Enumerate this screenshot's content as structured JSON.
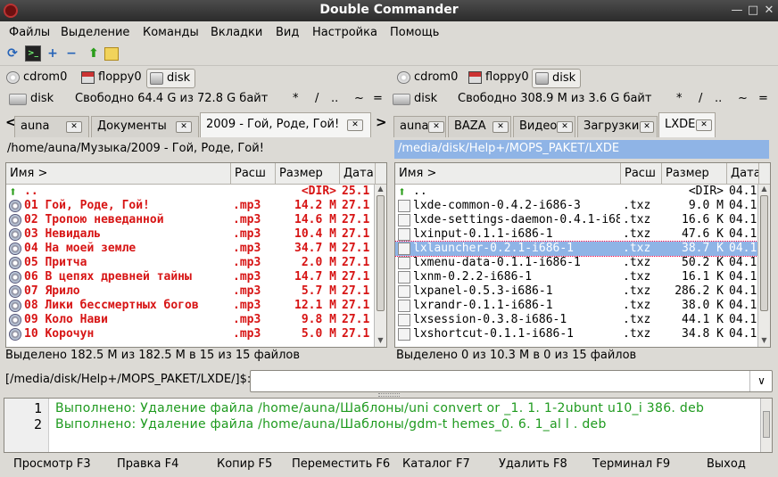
{
  "window": {
    "title": "Double Commander"
  },
  "menu": [
    "Файлы",
    "Выделение",
    "Команды",
    "Вкладки",
    "Вид",
    "Настройка",
    "Помощь"
  ],
  "drives": {
    "left": [
      "cdrom0",
      "floppy0",
      "disk"
    ],
    "right": [
      "cdrom0",
      "floppy0",
      "disk"
    ],
    "selected": "disk"
  },
  "left": {
    "disk_label": "disk",
    "free_text": "Свободно 64.4 G из 72.8 G байт",
    "nav": [
      "*",
      "/",
      "..",
      "~",
      "="
    ],
    "tabs": [
      {
        "label": "auna"
      },
      {
        "label": "Документы"
      },
      {
        "label": "2009 - Гой, Роде, Гой!"
      }
    ],
    "active_tab": 2,
    "path": "/home/auna/Музыка/2009 - Гой, Роде, Гой!",
    "columns": [
      "Имя >",
      "Расш",
      "Размер",
      "Дата"
    ],
    "files": [
      {
        "name": "..",
        "ext": "",
        "size": "<DIR>",
        "date": "25.1",
        "icon": "up-icon",
        "red": true
      },
      {
        "name": "01 Гой, Роде, Гой!",
        "ext": ".mp3",
        "size": "14.2 M",
        "date": "27.1",
        "icon": "audio-disc-icon",
        "red": true
      },
      {
        "name": "02 Тропою неведанной",
        "ext": ".mp3",
        "size": "14.6 M",
        "date": "27.1",
        "icon": "audio-disc-icon",
        "red": true
      },
      {
        "name": "03 Невидаль",
        "ext": ".mp3",
        "size": "10.4 M",
        "date": "27.1",
        "icon": "audio-disc-icon",
        "red": true
      },
      {
        "name": "04 На моей земле",
        "ext": ".mp3",
        "size": "34.7 M",
        "date": "27.1",
        "icon": "audio-disc-icon",
        "red": true
      },
      {
        "name": "05 Притча",
        "ext": ".mp3",
        "size": "2.0 M",
        "date": "27.1",
        "icon": "audio-disc-icon",
        "red": true
      },
      {
        "name": "06 В цепях древней тайны",
        "ext": ".mp3",
        "size": "14.7 M",
        "date": "27.1",
        "icon": "audio-disc-icon",
        "red": true
      },
      {
        "name": "07 Ярило",
        "ext": ".mp3",
        "size": "5.7 M",
        "date": "27.1",
        "icon": "audio-disc-icon",
        "red": true
      },
      {
        "name": "08 Лики бессмертных богов",
        "ext": ".mp3",
        "size": "12.1 M",
        "date": "27.1",
        "icon": "audio-disc-icon",
        "red": true
      },
      {
        "name": "09 Коло Нави",
        "ext": ".mp3",
        "size": "9.8 M",
        "date": "27.1",
        "icon": "audio-disc-icon",
        "red": true
      },
      {
        "name": "10 Корочун",
        "ext": ".mp3",
        "size": "5.0 M",
        "date": "27.1",
        "icon": "audio-disc-icon",
        "red": true
      }
    ],
    "status": "Выделено 182.5 M из 182.5 M в 15 из 15 файлов"
  },
  "right": {
    "disk_label": "disk",
    "free_text": "Свободно 308.9 M из 3.6 G байт",
    "nav": [
      "*",
      "/",
      "..",
      "~",
      "="
    ],
    "tabs": [
      {
        "label": "auna"
      },
      {
        "label": "BAZA"
      },
      {
        "label": "Видео"
      },
      {
        "label": "Загрузки"
      },
      {
        "label": "LXDE"
      }
    ],
    "active_tab": 4,
    "path": "/media/disk/Help+/MOPS_PAKET/LXDE",
    "columns": [
      "Имя >",
      "Расш",
      "Размер",
      "Дата"
    ],
    "files": [
      {
        "name": "..",
        "ext": "",
        "size": "<DIR>",
        "date": "04.1",
        "icon": "up-icon"
      },
      {
        "name": "lxde-common-0.4.2-i686-3",
        "ext": ".txz",
        "size": "9.0 M",
        "date": "04.1",
        "icon": "file-icon"
      },
      {
        "name": "lxde-settings-daemon-0.4.1-i68",
        "ext": ".txz",
        "size": "16.6 K",
        "date": "04.1",
        "icon": "file-icon"
      },
      {
        "name": "lxinput-0.1.1-i686-1",
        "ext": ".txz",
        "size": "47.6 K",
        "date": "04.1",
        "icon": "file-icon"
      },
      {
        "name": "lxlauncher-0.2.1-i686-1",
        "ext": ".txz",
        "size": "38.7 K",
        "date": "04.1",
        "icon": "file-icon",
        "selected": true
      },
      {
        "name": "lxmenu-data-0.1.1-i686-1",
        "ext": ".txz",
        "size": "50.2 K",
        "date": "04.1",
        "icon": "file-icon"
      },
      {
        "name": "lxnm-0.2.2-i686-1",
        "ext": ".txz",
        "size": "16.1 K",
        "date": "04.1",
        "icon": "file-icon"
      },
      {
        "name": "lxpanel-0.5.3-i686-1",
        "ext": ".txz",
        "size": "286.2 K",
        "date": "04.1",
        "icon": "file-icon"
      },
      {
        "name": "lxrandr-0.1.1-i686-1",
        "ext": ".txz",
        "size": "38.0 K",
        "date": "04.1",
        "icon": "file-icon"
      },
      {
        "name": "lxsession-0.3.8-i686-1",
        "ext": ".txz",
        "size": "44.1 K",
        "date": "04.1",
        "icon": "file-icon"
      },
      {
        "name": "lxshortcut-0.1.1-i686-1",
        "ext": ".txz",
        "size": "34.8 K",
        "date": "04.1",
        "icon": "file-icon"
      }
    ],
    "status": "Выделено 0 из 10.3 M в 0 из 15 файлов"
  },
  "cmdline": {
    "prompt": "[/media/disk/Help+/MOPS_PAKET/LXDE/]$:",
    "value": ""
  },
  "log": [
    {
      "num": "1",
      "text": "Выполнено:  Удаление  файла  /home/auna/Шаблоны/uni convert or _1. 1. 1-2ubunt u10_i 386. deb"
    },
    {
      "num": "2",
      "text": "Выполнено:  Удаление  файла  /home/auna/Шаблоны/gdm-t hemes_0. 6. 1_al l . deb"
    }
  ],
  "fkeys": [
    "Просмотр F3",
    "Правка F4",
    "Копир F5",
    "Переместить F6",
    "Каталог F7",
    "Удалить F8",
    "Терминал F9",
    "Выход"
  ],
  "colors": {
    "selection": "#8fb4e6",
    "red_files": "#d71414",
    "log_green": "#1e9a1e"
  }
}
